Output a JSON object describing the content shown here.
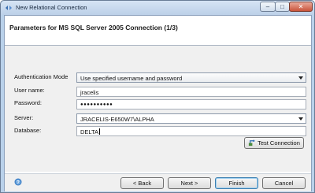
{
  "window": {
    "title": "New Relational Connection",
    "controls": {
      "minimize": "–",
      "maximize": "□",
      "close": "✕"
    }
  },
  "header": {
    "title": "Parameters for MS SQL Server 2005 Connection (1/3)"
  },
  "form": {
    "auth_mode_label": "Authentication Mode",
    "auth_mode_value": "Use specified username and password",
    "username_label": "User name:",
    "username_value": "jracelis",
    "password_label": "Password:",
    "password_value": "●●●●●●●●●●",
    "server_label": "Server:",
    "server_value": "JRACELIS-E650W7\\ALPHA",
    "database_label": "Database:",
    "database_value": "DELTA",
    "test_connection_label": "Test Connection"
  },
  "footer": {
    "back_label": "Back",
    "next_label": "Next",
    "finish_label": "Finish",
    "cancel_label": "Cancel"
  },
  "icons": {
    "app": "connection-icon",
    "help": "help-icon",
    "test": "test-connection-icon"
  },
  "colors": {
    "titlebar": "#bcd0e8",
    "form_bg": "#f0f0f0",
    "default_button_border": "#3c7fb1"
  }
}
